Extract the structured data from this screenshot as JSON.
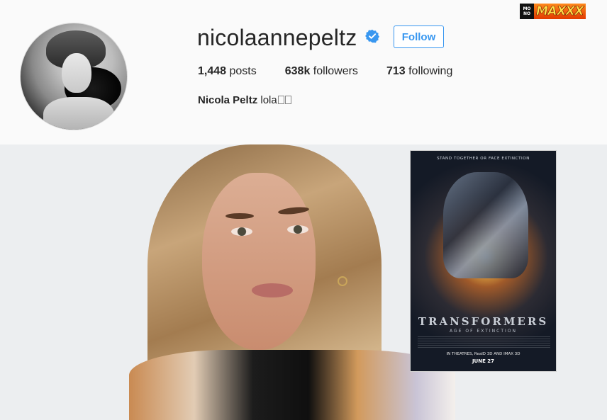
{
  "profile": {
    "username": "nicolaannepeltz",
    "follow_label": "Follow",
    "stats": {
      "posts_count": "1,448",
      "posts_label": "posts",
      "followers_count": "638k",
      "followers_label": "followers",
      "following_count": "713",
      "following_label": "following"
    },
    "bio": {
      "name": "Nicola Peltz",
      "text": "lola"
    },
    "icons": {
      "verified": "verified-badge-icon"
    }
  },
  "watermark": {
    "box_top": "MO",
    "box_bottom": "NO",
    "text": "MAXXX"
  },
  "poster": {
    "tagline": "STAND TOGETHER OR FACE EXTINCTION",
    "title": "TRANSFORMERS",
    "subtitle": "AGE OF EXTINCTION",
    "release": "IN THEATRES, RealD 3D AND IMAX 3D",
    "date": "JUNE 27"
  },
  "colors": {
    "accent": "#3897f0",
    "text": "#262626",
    "background": "#fafafa"
  }
}
